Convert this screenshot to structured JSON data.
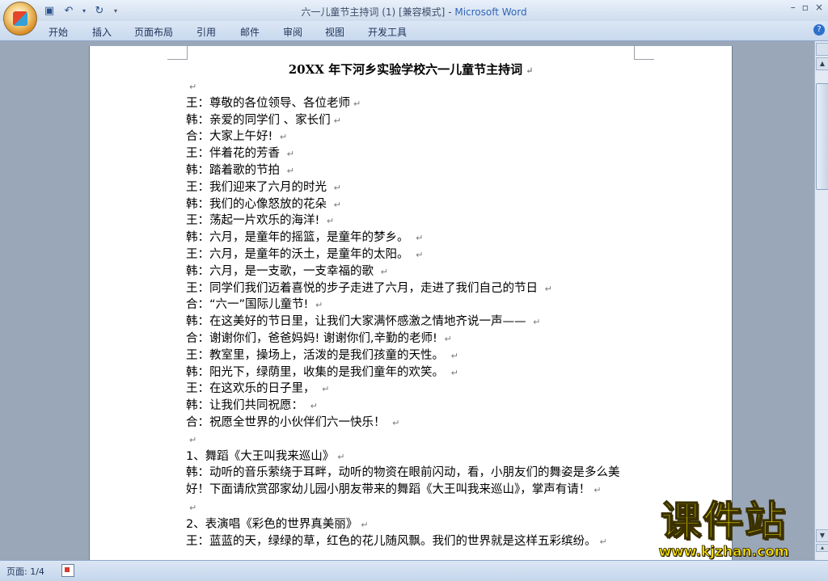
{
  "window": {
    "doc_name": "六一儿童节主持词 (1) [兼容模式]",
    "separator": " - ",
    "app_name": "Microsoft Word",
    "controls": [
      "–",
      "▫",
      "×"
    ]
  },
  "ribbon": {
    "tabs": [
      "开始",
      "插入",
      "页面布局",
      "引用",
      "邮件",
      "审阅",
      "视图",
      "开发工具"
    ]
  },
  "document": {
    "title": "20XX 年下河乡实验学校六一儿童节主持词",
    "para_mark": "↵",
    "lines": [
      "",
      "王：尊敬的各位领导、各位老师",
      "韩：亲爱的同学们 、家长们",
      "合：大家上午好! ",
      "王：伴着花的芳香 ",
      "韩：踏着歌的节拍 ",
      "王：我们迎来了六月的时光 ",
      "韩：我们的心像怒放的花朵 ",
      "王：荡起一片欢乐的海洋! ",
      "韩：六月，是童年的摇篮，是童年的梦乡。 ",
      "王：六月，是童年的沃土，是童年的太阳。 ",
      "韩：六月，是一支歌，一支幸福的歌 ",
      "王：同学们我们迈着喜悦的步子走进了六月，走进了我们自己的节日 ",
      "合：“六一”国际儿童节! ",
      "韩：在这美好的节日里，让我们大家满怀感激之情地齐说一声—— ",
      "合：谢谢你们，爸爸妈妈! 谢谢你们,辛勤的老师! ",
      "王：教室里，操场上，活泼的是我们孩童的天性。 ",
      "韩：阳光下，绿荫里，收集的是我们童年的欢笑。 ",
      "王：在这欢乐的日子里， ",
      "韩：让我们共同祝愿： ",
      "合：祝愿全世界的小伙伴们六一快乐！ ",
      "",
      "1、舞蹈《大王叫我来巡山》"
    ],
    "paragraph": " 韩：动听的音乐萦绕于耳畔，动听的物资在眼前闪动，看，小朋友们的舞姿是多么美好！下面请欣赏邵家幼儿园小朋友带来的舞蹈《大王叫我来巡山》，掌声有请！",
    "lines_after": [
      "",
      "2、表演唱《彩色的世界真美丽》",
      "王：蓝蓝的天，绿绿的草，红色的花儿随风飘。我们的世界就是这样五彩缤纷。"
    ]
  },
  "status": {
    "page": "页面: 1/4"
  },
  "watermark": {
    "text": "课件站",
    "url": "www.kjzhan.com"
  }
}
